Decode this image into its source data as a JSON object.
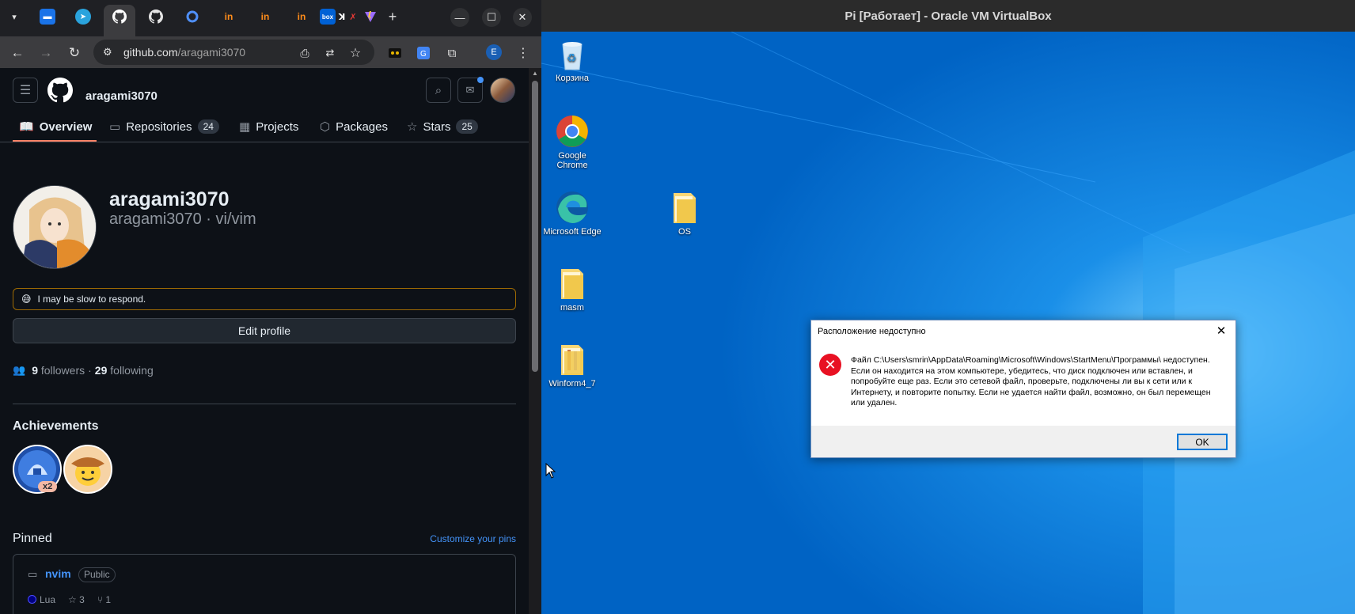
{
  "browser": {
    "tabs": [
      {
        "icon": "tab-list-icon"
      },
      {
        "icon": "chat-icon"
      },
      {
        "icon": "telegram-icon"
      },
      {
        "icon": "github-icon",
        "active": true
      },
      {
        "icon": "github-icon"
      },
      {
        "icon": "circle-icon"
      },
      {
        "icon": "invision-icon"
      },
      {
        "icon": "invision-icon"
      },
      {
        "icon": "invision-icon"
      },
      {
        "icon": "box-icon",
        "label": "box"
      },
      {
        "icon": "vite-icon"
      }
    ],
    "new_tab": "+",
    "url_host": "github.com",
    "url_path": "/aragami3070",
    "profile_initial": "E",
    "window_controls": {
      "minimize": "—",
      "maximize": "☐",
      "close": "✕"
    }
  },
  "github": {
    "header_username": "aragami3070",
    "nav": [
      {
        "label": "Overview",
        "icon": "book-icon"
      },
      {
        "label": "Repositories",
        "icon": "repo-icon",
        "count": "24"
      },
      {
        "label": "Projects",
        "icon": "table-icon"
      },
      {
        "label": "Packages",
        "icon": "package-icon"
      },
      {
        "label": "Stars",
        "icon": "star-icon",
        "count": "25"
      }
    ],
    "profile": {
      "name": "aragami3070",
      "login_line": "aragami3070 · vi/vim",
      "status_emoji": "😅",
      "status_text": "I may be slow to respond.",
      "edit_button": "Edit profile",
      "followers_count": "9",
      "followers_label": "followers",
      "separator": "·",
      "following_count": "29",
      "following_label": "following"
    },
    "achievements": {
      "title": "Achievements",
      "badge_multiplier": "x2"
    },
    "pinned": {
      "title": "Pinned",
      "customize": "Customize your pins",
      "repo": {
        "name": "nvim",
        "visibility": "Public",
        "language": "Lua",
        "stars": "3",
        "forks": "1"
      }
    }
  },
  "virtualbox": {
    "window_title": "Pi [Работает] - Oracle VM VirtualBox",
    "desktop_icons": [
      {
        "label": "Корзина",
        "icon": "recycle-bin-icon"
      },
      {
        "label": "Google Chrome",
        "icon": "chrome-icon"
      },
      {
        "label": "Microsoft Edge",
        "icon": "edge-icon"
      },
      {
        "label": "OS",
        "icon": "folder-icon"
      },
      {
        "label": "masm",
        "icon": "folder-icon"
      },
      {
        "label": "Winform4_7",
        "icon": "folder-icon"
      }
    ],
    "dialog": {
      "title": "Расположение недоступно",
      "message": "Файл C:\\Users\\smrin\\AppData\\Roaming\\Microsoft\\Windows\\StartMenu\\Программы\\ недоступен. Если он находится на этом компьютере, убедитесь, что диск подключен или вставлен, и попробуйте еще раз. Если это сетевой файл, проверьте, подключены ли вы к сети или к Интернету, и повторите попытку. Если не удается найти файл, возможно, он был перемещен или удален.",
      "ok_button": "OK"
    }
  },
  "colors": {
    "github_bg": "#0d1117",
    "link": "#4493f8",
    "nav_underline": "#f78166",
    "desktop": "#0078d7",
    "error": "#e81123"
  }
}
